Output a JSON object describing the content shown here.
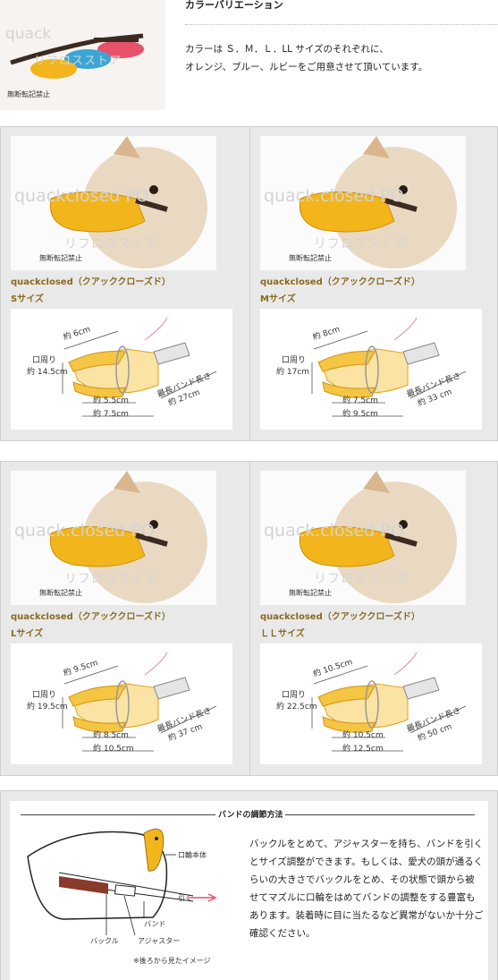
{
  "top": {
    "photo": {
      "watermark": "quack",
      "watermark2": "リフロスストア",
      "caption": "無断転記禁止"
    },
    "title": "カラーバリエーション",
    "desc_line1": "カラーは Ｓ．Ｍ．Ｌ．LL サイズのそれぞれに、",
    "desc_line2": "オレンジ、ブルー、ルビーをご用意させて頂いています。",
    "colors": {
      "orange": "#f2b51c",
      "blue": "#3aa6d8",
      "ruby": "#e8516a",
      "strap": "#3b2a20"
    }
  },
  "sizes": [
    {
      "photo_watermark": "quackclosed PO",
      "photo_watermark2": "リフロスストア",
      "photo_caption": "無断転記禁止",
      "name": "quackclosed（クアッククローズド）",
      "size": "Sサイズ",
      "d_top": "約 6cm",
      "d_mouth_label": "口周り",
      "d_mouth": "約 14.5cm",
      "d_inner": "約 5.5cm",
      "d_outer": "約 7.5cm",
      "d_band_label": "最長バンド長さ",
      "d_band": "約 27cm"
    },
    {
      "photo_watermark": "quack.closed PO",
      "photo_watermark2": "リフロスストア",
      "photo_caption": "無断転記禁止",
      "name": "quackclosed（クアッククローズド）",
      "size": "Mサイズ",
      "d_top": "約 8cm",
      "d_mouth_label": "口周り",
      "d_mouth": "約 17cm",
      "d_inner": "約 7.5cm",
      "d_outer": "約 9.5cm",
      "d_band_label": "最長バンド長さ",
      "d_band": "約 33 cm"
    },
    {
      "photo_watermark": "quack.closed PO",
      "photo_watermark2": "リフロスストア",
      "photo_caption": "無断転記禁止",
      "name": "quackclosed（クアッククローズド）",
      "size": "Lサイズ",
      "d_top": "約 9.5cm",
      "d_mouth_label": "口周り",
      "d_mouth": "約 19.5cm",
      "d_inner": "約 8.5cm",
      "d_outer": "約 10.5cm",
      "d_band_label": "最長バンド長さ",
      "d_band": "約 37 cm"
    },
    {
      "photo_watermark": "quack.closed PO",
      "photo_watermark2": "リフロスストア",
      "photo_caption": "無断転記禁止",
      "name": "quackclosed（クアッククローズド）",
      "size": "ＬＬサイズ",
      "d_top": "約 10.5cm",
      "d_mouth_label": "口周り",
      "d_mouth": "約 22.5cm",
      "d_inner": "約 10.5cm",
      "d_outer": "約 12.5cm",
      "d_band_label": "最長バンド長さ",
      "d_band": "約 50 cm"
    }
  ],
  "band": {
    "title": "バンドの調節方法",
    "desc": "バックルをとめて、アジャスターを持ち、バンドを引くとサイズ調整ができます。もしくは、愛犬の頭が通るくらいの大きさでバックルをとめ、その状態で頭から被せてマズルに口輪をはめてバンドの調整をする豊富もあります。装着時に目に当たるなど異常がないか十分ご確認ください。",
    "labels": {
      "body": "口輪本体",
      "pull": "引く",
      "band": "バンド",
      "buckle": "バックル",
      "adjuster": "アジャスター",
      "note": "※後ろから見たイメージ"
    }
  }
}
